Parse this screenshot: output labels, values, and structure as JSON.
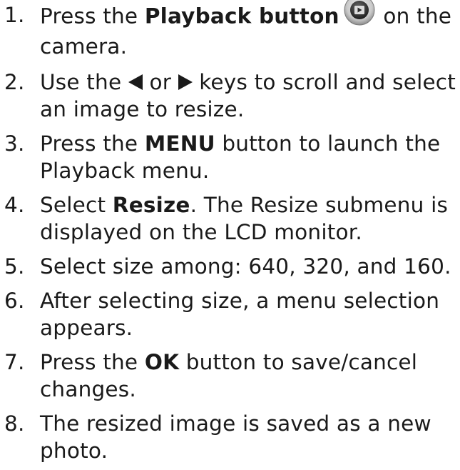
{
  "steps": [
    {
      "number": "1.",
      "pre": "Press the ",
      "bold": "Playback button",
      "icon": "playback-button-icon",
      "post": " on the camera."
    },
    {
      "number": "2.",
      "pre": "Use the ",
      "key_left": "left-arrow-key-icon",
      "mid": " or ",
      "key_right": "right-arrow-key-icon",
      "post": " keys to scroll and select an image to resize."
    },
    {
      "number": "3.",
      "pre": "Press the ",
      "bold": "MENU",
      "post": " button to launch the Playback menu."
    },
    {
      "number": "4.",
      "pre": "Select ",
      "bold": "Resize",
      "post": ". The Resize submenu is displayed on the LCD monitor."
    },
    {
      "number": "5.",
      "text": "Select size among: 640, 320, and 160."
    },
    {
      "number": "6.",
      "text": "After selecting size, a menu selection appears."
    },
    {
      "number": "7.",
      "pre": "Press the ",
      "bold": "OK",
      "post": " button to save/cancel changes."
    },
    {
      "number": "8.",
      "text": "The resized image is saved as a new photo."
    }
  ]
}
